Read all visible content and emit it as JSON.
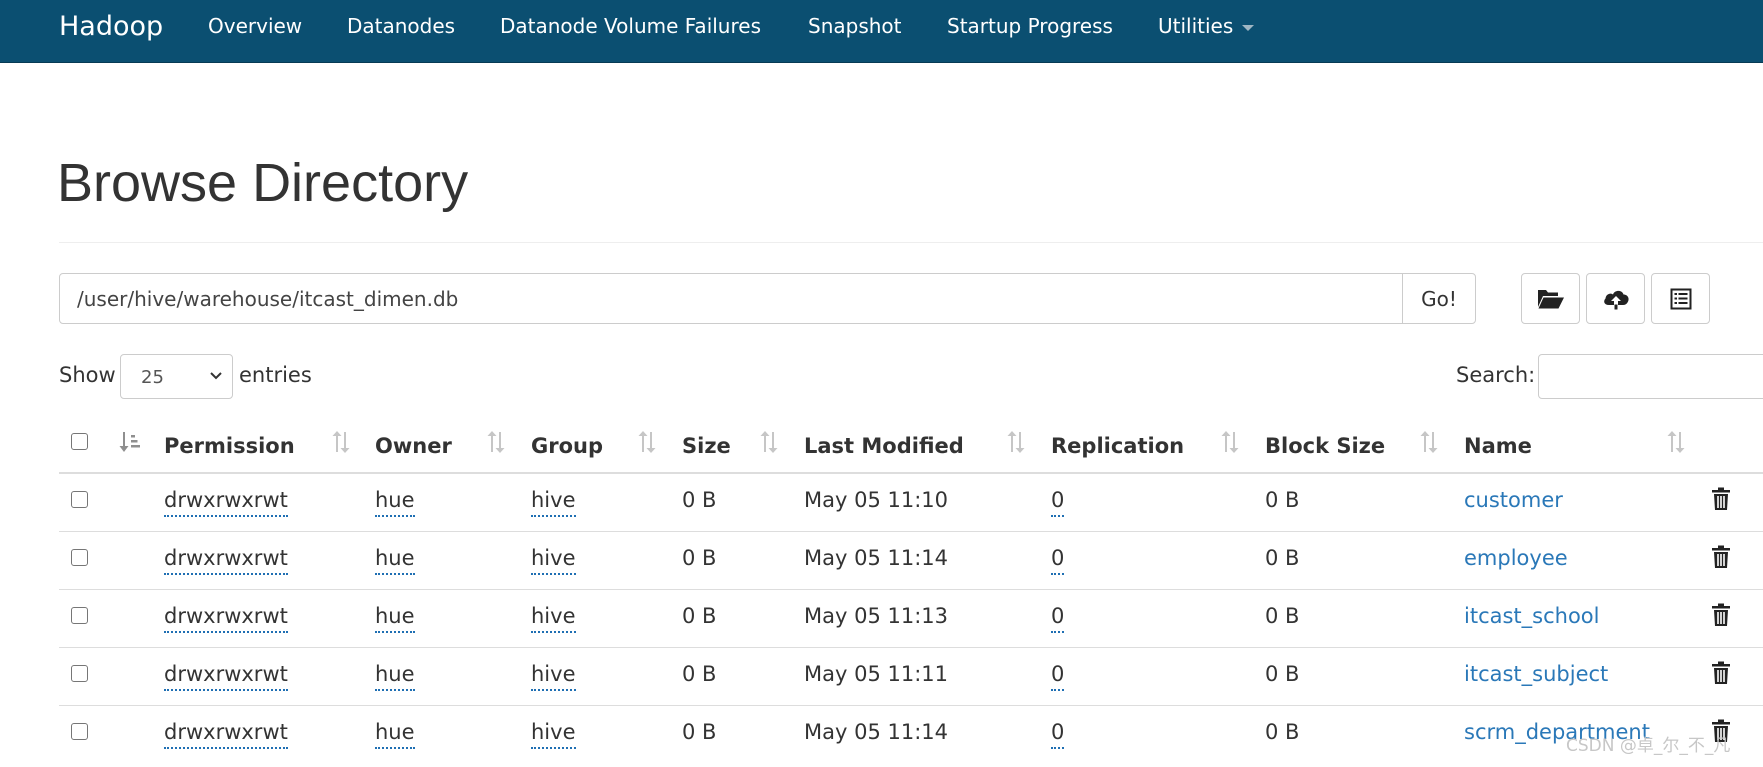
{
  "navbar": {
    "brand": "Hadoop",
    "items": [
      "Overview",
      "Datanodes",
      "Datanode Volume Failures",
      "Snapshot",
      "Startup Progress",
      "Utilities"
    ]
  },
  "page_title": "Browse Directory",
  "path_bar": {
    "value": "/user/hive/warehouse/itcast_dimen.db",
    "go_label": "Go!"
  },
  "toolbar_icons": [
    "folder-open-icon",
    "cloud-upload-icon",
    "list-alt-icon"
  ],
  "table_controls": {
    "show_label": "Show",
    "page_size": "25",
    "entries_label": "entries",
    "search_label": "Search:",
    "search_value": ""
  },
  "table": {
    "columns": [
      "Permission",
      "Owner",
      "Group",
      "Size",
      "Last Modified",
      "Replication",
      "Block Size",
      "Name"
    ],
    "rows": [
      {
        "permission": "drwxrwxrwt",
        "owner": "hue",
        "group": "hive",
        "size": "0 B",
        "last_modified": "May 05 11:10",
        "replication": "0",
        "block_size": "0 B",
        "name": "customer"
      },
      {
        "permission": "drwxrwxrwt",
        "owner": "hue",
        "group": "hive",
        "size": "0 B",
        "last_modified": "May 05 11:14",
        "replication": "0",
        "block_size": "0 B",
        "name": "employee"
      },
      {
        "permission": "drwxrwxrwt",
        "owner": "hue",
        "group": "hive",
        "size": "0 B",
        "last_modified": "May 05 11:13",
        "replication": "0",
        "block_size": "0 B",
        "name": "itcast_school"
      },
      {
        "permission": "drwxrwxrwt",
        "owner": "hue",
        "group": "hive",
        "size": "0 B",
        "last_modified": "May 05 11:11",
        "replication": "0",
        "block_size": "0 B",
        "name": "itcast_subject"
      },
      {
        "permission": "drwxrwxrwt",
        "owner": "hue",
        "group": "hive",
        "size": "0 B",
        "last_modified": "May 05 11:14",
        "replication": "0",
        "block_size": "0 B",
        "name": "scrm_department"
      }
    ]
  },
  "watermark": "CSDN @卓_尔_不_凡",
  "colors": {
    "navbar": "#0b4f71",
    "link": "#2a78b8",
    "text": "#333333",
    "border": "#cccccc"
  }
}
